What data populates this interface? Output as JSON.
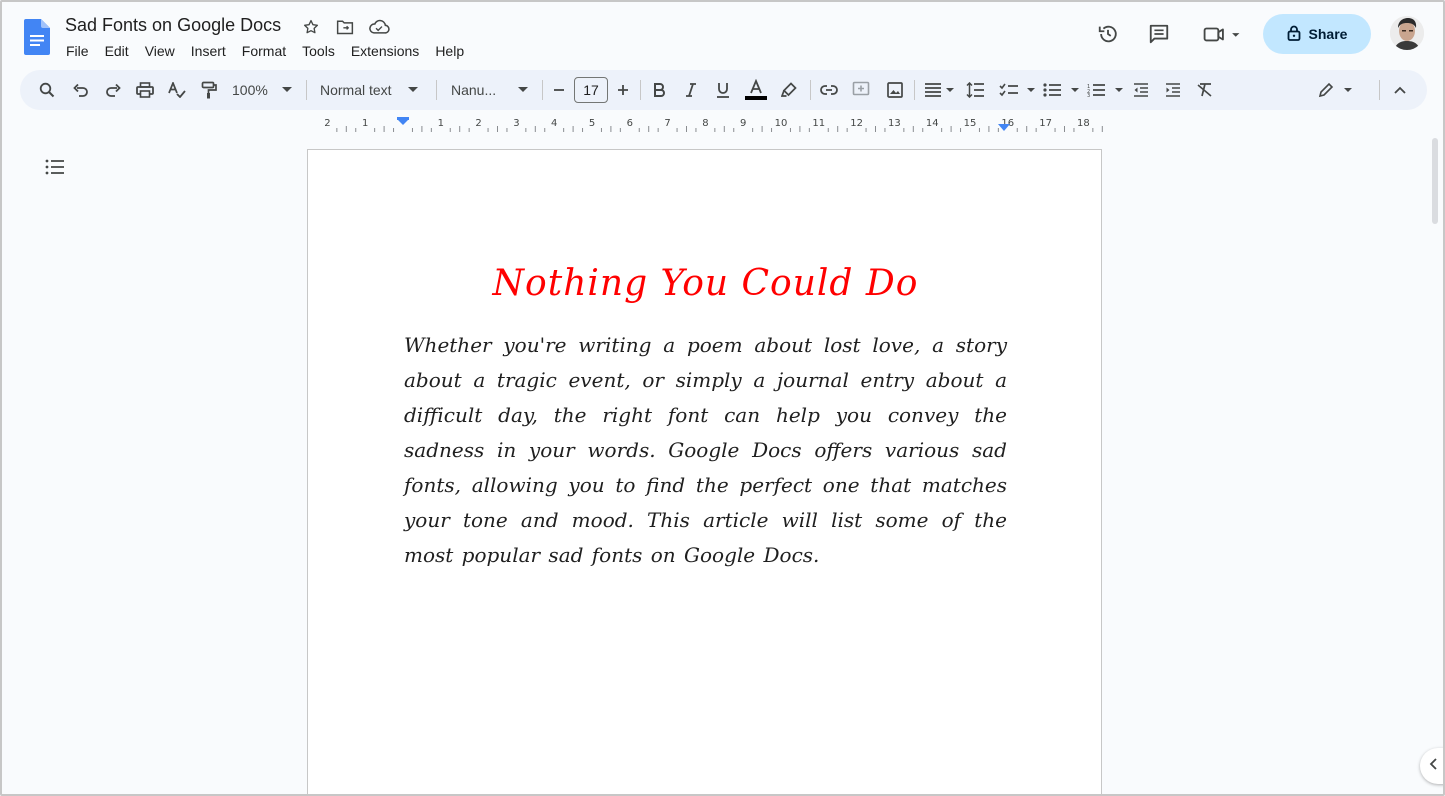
{
  "document": {
    "title": "Sad Fonts on Google Docs",
    "heading": "Nothing You Could Do",
    "body": "Whether you're writing a poem about lost love, a story about a tragic event, or simply a journal entry about a difficult day, the right font can help you convey the sadness in your words. Google Docs offers various sad fonts, allowing you to find the perfect one that matches your tone and mood. This article will list some of the most popular sad fonts on Google Docs."
  },
  "menu": [
    "File",
    "Edit",
    "View",
    "Insert",
    "Format",
    "Tools",
    "Extensions",
    "Help"
  ],
  "header": {
    "share_label": "Share"
  },
  "toolbar": {
    "zoom": "100%",
    "style": "Normal text",
    "font": "Nanu...",
    "font_size": "17"
  },
  "ruler": {
    "labels": [
      "2",
      "1",
      "1",
      "2",
      "3",
      "4",
      "5",
      "6",
      "7",
      "8",
      "9",
      "10",
      "11",
      "12",
      "13",
      "14",
      "15",
      "16",
      "17",
      "18"
    ]
  },
  "colors": {
    "accent": "#0b57d0",
    "share_bg": "#c2e7ff",
    "heading_color": "#ff0000",
    "toolbar_bg": "#edf2fa",
    "docs_blue": "#4285f4"
  },
  "icons": [
    "docs-logo-icon",
    "star-icon",
    "move-folder-icon",
    "cloud-saved-icon",
    "history-icon",
    "comment-icon",
    "meet-icon",
    "lock-icon",
    "search-icon",
    "undo-icon",
    "redo-icon",
    "print-icon",
    "spellcheck-icon",
    "paint-format-icon",
    "bold-icon",
    "italic-icon",
    "underline-icon",
    "text-color-icon",
    "highlight-icon",
    "link-icon",
    "add-comment-icon",
    "image-icon",
    "align-icon",
    "line-spacing-icon",
    "checklist-icon",
    "bullet-list-icon",
    "numbered-list-icon",
    "decrease-indent-icon",
    "increase-indent-icon",
    "clear-formatting-icon",
    "editing-mode-icon",
    "collapse-icon",
    "outline-icon",
    "side-panel-toggle-icon"
  ]
}
